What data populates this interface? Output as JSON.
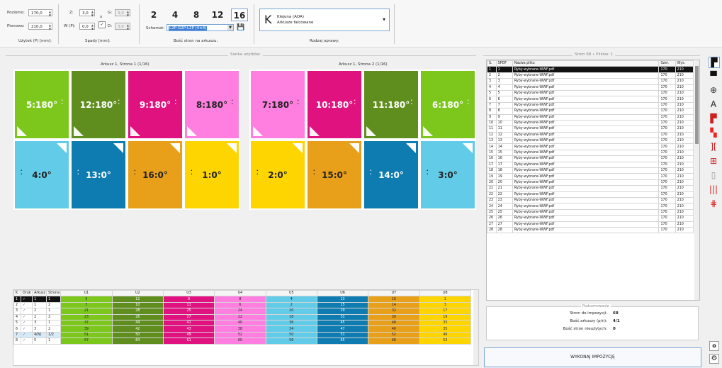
{
  "toolbar": {
    "poziomo_label": "Poziomo:",
    "poziomo_value": "170,0",
    "pionowo_label": "Pionowo:",
    "pionowo_value": "210,0",
    "uzytek_label": "Użytek (P) [mm]:",
    "z_label": "Z:",
    "z_value": "3,0",
    "wp_label": "W (P):",
    "wp_value": "0,0",
    "g_label": "G:",
    "g_value": "3,0",
    "d_label": "D:",
    "d_value": "3,0",
    "x_label": "x",
    "spady_label": "Spady [mm]:",
    "pages": [
      "2",
      "4",
      "8",
      "12",
      "16"
    ],
    "active_pages": "16",
    "schemat_label": "Schemat:",
    "schemat_value": "L2P-G2P-L2P (4×4)",
    "bosc_label": "Bość stron na arkuszu:",
    "oprawa_letter": "K",
    "oprawa_line1": "Klejona (AOA)",
    "oprawa_line2": "Arkusze falcowane",
    "oprawa_label": "Rodzaj oprawy:"
  },
  "layout_panel": {
    "title": "Siatka użytków:",
    "sheet1_label": "Arkusz 1, Strona 1 (1/16)",
    "sheet2_label": "Arkusz 1, Strona 2 (1/16)",
    "colors": {
      "green": "#7dc71d",
      "dkgreen": "#5f8e1e",
      "magenta": "#e0127f",
      "pink": "#ff7fe0",
      "cyan": "#62cbe8",
      "blue": "#0e7cb0",
      "orange": "#e8a01a",
      "yellow": "#ffd500"
    },
    "sheet1_top": [
      {
        "text": "5:180°",
        "c": "green"
      },
      {
        "text": "12:180°",
        "c": "dkgreen"
      },
      {
        "text": "9:180°",
        "c": "magenta"
      },
      {
        "text": "8:180°",
        "c": "pink"
      }
    ],
    "sheet1_bottom": [
      {
        "text": "4:0°",
        "c": "cyan"
      },
      {
        "text": "13:0°",
        "c": "blue"
      },
      {
        "text": "16:0°",
        "c": "orange"
      },
      {
        "text": "1:0°",
        "c": "yellow"
      }
    ],
    "sheet2_top": [
      {
        "text": "7:180°",
        "c": "pink"
      },
      {
        "text": "10:180°",
        "c": "magenta"
      },
      {
        "text": "11:180°",
        "c": "dkgreen"
      },
      {
        "text": "6:180°",
        "c": "green"
      }
    ],
    "sheet2_bottom": [
      {
        "text": "2:0°",
        "c": "yellow"
      },
      {
        "text": "15:0°",
        "c": "orange"
      },
      {
        "text": "14:0°",
        "c": "blue"
      },
      {
        "text": "3:0°",
        "c": "cyan"
      }
    ]
  },
  "sheet_table": {
    "headers": [
      "K",
      "Druk",
      "Arkusz",
      "Strona",
      "U1",
      "U2",
      "U3",
      "U4",
      "U5",
      "U6",
      "U7",
      "U8"
    ],
    "rows": [
      [
        "1",
        "✓",
        "1",
        "1",
        "5",
        "12",
        "9",
        "8",
        "4",
        "13",
        "16",
        "1"
      ],
      [
        "2",
        "✓",
        "1",
        "2",
        "7",
        "10",
        "11",
        "6",
        "2",
        "15",
        "14",
        "3"
      ],
      [
        "3",
        "✓",
        "2",
        "1",
        "21",
        "28",
        "25",
        "24",
        "20",
        "29",
        "32",
        "17"
      ],
      [
        "4",
        "✓",
        "2",
        "2",
        "23",
        "26",
        "27",
        "22",
        "18",
        "31",
        "30",
        "19"
      ],
      [
        "5",
        "✓",
        "3",
        "1",
        "37",
        "44",
        "41",
        "40",
        "36",
        "45",
        "48",
        "33"
      ],
      [
        "6",
        "✓",
        "3",
        "2",
        "39",
        "42",
        "43",
        "38",
        "34",
        "47",
        "46",
        "35"
      ],
      [
        "7",
        "✓",
        "4(N)",
        "1/2",
        "51",
        "50",
        "49",
        "52",
        "50",
        "51",
        "52",
        "49"
      ],
      [
        "8",
        "✓",
        "5",
        "1",
        "57",
        "64",
        "61",
        "60",
        "56",
        "65",
        "68",
        "53"
      ]
    ],
    "col_colors": [
      "green",
      "dkgreen",
      "magenta",
      "pink",
      "cyan",
      "blue",
      "orange",
      "yellow"
    ]
  },
  "file_panel": {
    "title": "Stron 68 • Plików: 1",
    "headers": [
      "S.",
      "SPDF",
      "Nazwa pliku",
      "Szer.",
      "Wys."
    ],
    "file": "Ryby-wybrane-WWF.pdf",
    "width": "170",
    "height": "210",
    "rows": [
      "1",
      "2",
      "3",
      "4",
      "5",
      "6",
      "7",
      "8",
      "9",
      "10",
      "11",
      "12",
      "13",
      "14",
      "15",
      "16",
      "17",
      "18",
      "19",
      "20",
      "21",
      "22",
      "23",
      "24",
      "25",
      "26",
      "27",
      "28"
    ]
  },
  "summary": {
    "title": "Podsumowanie",
    "stron_label": "Stron do impozycji:",
    "stron_value": "68",
    "arkuszy_label": "Bość arkuszy (p/n):",
    "arkuszy_value": "4/1",
    "nieuzytych_label": "Bość stron nieużytych:",
    "nieuzytych_value": "0"
  },
  "execute_button": "WYKONAJ IMPOZYCJĘ",
  "right_icons": [
    "top-left-fold-icon",
    "top-fold-icon",
    "crosshair-icon",
    "text-A-icon",
    "color-bar-icon",
    "red-fold-icon",
    "column-split-icon",
    "grid-icon",
    "page-gray-icon",
    "red-lines-icon",
    "cut-marks-icon"
  ]
}
